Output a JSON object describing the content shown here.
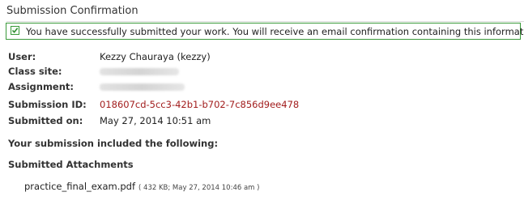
{
  "header": {
    "title": "Submission Confirmation"
  },
  "alert": {
    "message": "You have successfully submitted your work. You will receive an email confirmation containing this information.",
    "icon": "checkbox-check-icon",
    "color": "#3a9a3a"
  },
  "details": {
    "user_label": "User:",
    "user_value": "Kezzy Chauraya (kezzy)",
    "site_label": "Class site:",
    "assignment_label": "Assignment:",
    "submission_id_label": "Submission ID:",
    "submission_id_value": "018607cd-5cc3-42b1-b702-7c856d9ee478",
    "submitted_on_label": "Submitted on:",
    "submitted_on_value": "May 27, 2014 10:51 am"
  },
  "included": {
    "heading": "Your submission included the following:"
  },
  "attachments": {
    "heading": "Submitted Attachments",
    "items": [
      {
        "name": "practice_final_exam.pdf",
        "meta": "( 432 KB; May 27, 2014 10:46 am )"
      }
    ]
  }
}
